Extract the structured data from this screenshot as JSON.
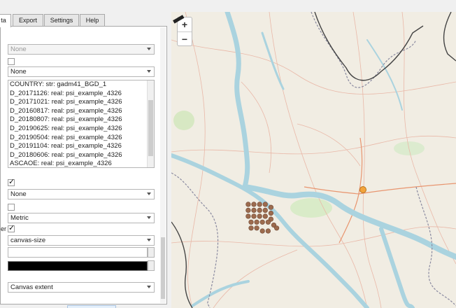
{
  "tabs": [
    {
      "label": "ta",
      "active": true
    },
    {
      "label": "Export",
      "active": false
    },
    {
      "label": "Settings",
      "active": false
    },
    {
      "label": "Help",
      "active": false
    }
  ],
  "panel": {
    "dropdown1": "None",
    "dropdown2": "None",
    "fields": [
      "COUNTRY: str: gadm41_BGD_1",
      "D_20171126: real: psi_example_4326",
      "D_20171021: real: psi_example_4326",
      "D_20160817: real: psi_example_4326",
      "D_20180807: real: psi_example_4326",
      "D_20190625: real: psi_example_4326",
      "D_20190504: real: psi_example_4326",
      "D_20191104: real: psi_example_4326",
      "D_20180606: real: psi_example_4326",
      "ASCAOE: real: psi_example_4326"
    ],
    "dropdown3": "None",
    "units": "Metric",
    "er_label": "er",
    "size_mode": "canvas-size",
    "color_value": "#000000",
    "extent": "Canvas extent"
  },
  "map": {
    "zoom_in": "+",
    "zoom_out": "−",
    "points": [
      [
        0.27,
        0.65
      ],
      [
        0.29,
        0.65
      ],
      [
        0.31,
        0.65
      ],
      [
        0.33,
        0.65
      ],
      [
        0.35,
        0.66
      ],
      [
        0.27,
        0.67
      ],
      [
        0.29,
        0.67
      ],
      [
        0.31,
        0.67
      ],
      [
        0.33,
        0.67
      ],
      [
        0.35,
        0.68
      ],
      [
        0.27,
        0.69
      ],
      [
        0.29,
        0.69
      ],
      [
        0.31,
        0.69
      ],
      [
        0.33,
        0.69
      ],
      [
        0.35,
        0.7
      ],
      [
        0.28,
        0.71
      ],
      [
        0.3,
        0.71
      ],
      [
        0.32,
        0.71
      ],
      [
        0.34,
        0.71
      ],
      [
        0.36,
        0.72
      ],
      [
        0.28,
        0.73
      ],
      [
        0.3,
        0.73
      ],
      [
        0.32,
        0.74
      ],
      [
        0.34,
        0.74
      ],
      [
        0.37,
        0.73
      ]
    ]
  }
}
